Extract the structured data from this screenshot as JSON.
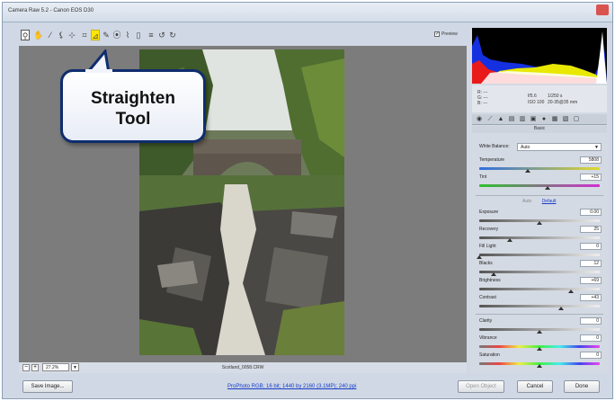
{
  "window": {
    "title": "Camera Raw 5.2 - Canon EOS D30"
  },
  "toolbar": {
    "tools": [
      {
        "name": "zoom-tool-icon",
        "glyph": "⚲"
      },
      {
        "name": "hand-tool-icon",
        "glyph": "✋"
      },
      {
        "name": "white-balance-tool-icon",
        "glyph": "⁄"
      },
      {
        "name": "color-sampler-tool-icon",
        "glyph": "⚸"
      },
      {
        "name": "targeted-adjustment-tool-icon",
        "glyph": "⊹"
      },
      {
        "name": "crop-tool-icon",
        "glyph": "⌗"
      },
      {
        "name": "straighten-tool-icon",
        "glyph": "⊿"
      },
      {
        "name": "spot-removal-tool-icon",
        "glyph": "✎"
      },
      {
        "name": "red-eye-tool-icon",
        "glyph": "⦿"
      },
      {
        "name": "adjustment-brush-icon",
        "glyph": "⌇"
      },
      {
        "name": "graduated-filter-icon",
        "glyph": "▯"
      },
      {
        "name": "preferences-icon",
        "glyph": "≡"
      },
      {
        "name": "rotate-left-icon",
        "glyph": "↺"
      },
      {
        "name": "rotate-right-icon",
        "glyph": "↻"
      }
    ],
    "active_tool_index": 6,
    "preview_label": "Preview",
    "preview_checked": true
  },
  "callout": {
    "line1": "Straighten",
    "line2": "Tool"
  },
  "status": {
    "zoom_value": "27.2%",
    "filename": "Scotland_0058.CRW"
  },
  "bottom": {
    "save_label": "Save Image...",
    "workflow_link": "ProPhoto RGB; 16 bit; 1440 by 2160 (3.1MP); 240 ppi",
    "open_label": "Open Object",
    "cancel_label": "Cancel",
    "done_label": "Done"
  },
  "info": {
    "r": "R:  ---",
    "g": "G:  ---",
    "b": "B:  ---",
    "aperture": "f/5.6",
    "shutter": "1/250 s",
    "iso": "ISO 100",
    "lens": "20-35@35 mm"
  },
  "panel": {
    "title": "Basic",
    "white_balance_label": "White Balance:",
    "white_balance_value": "Auto",
    "auto_label": "Auto",
    "default_label": "Default",
    "sliders": [
      {
        "key": "temperature",
        "label": "Temperature",
        "value": "5808",
        "fraction": 0.4,
        "track": "temp"
      },
      {
        "key": "tint",
        "label": "Tint",
        "value": "+15",
        "fraction": 0.57,
        "track": "tint"
      },
      {
        "key": "exposure",
        "label": "Exposure",
        "value": "0.00",
        "fraction": 0.5,
        "track": "gray"
      },
      {
        "key": "recovery",
        "label": "Recovery",
        "value": "25",
        "fraction": 0.25,
        "track": "gray"
      },
      {
        "key": "fill-light",
        "label": "Fill Light",
        "value": "0",
        "fraction": 0.0,
        "track": "gray"
      },
      {
        "key": "blacks",
        "label": "Blacks",
        "value": "12",
        "fraction": 0.12,
        "track": "gray"
      },
      {
        "key": "brightness",
        "label": "Brightness",
        "value": "+69",
        "fraction": 0.76,
        "track": "gray"
      },
      {
        "key": "contrast",
        "label": "Contrast",
        "value": "+43",
        "fraction": 0.68,
        "track": "gray"
      },
      {
        "key": "clarity",
        "label": "Clarity",
        "value": "0",
        "fraction": 0.5,
        "track": "gray"
      },
      {
        "key": "vibrance",
        "label": "Vibrance",
        "value": "0",
        "fraction": 0.5,
        "track": "sat"
      },
      {
        "key": "saturation",
        "label": "Saturation",
        "value": "0",
        "fraction": 0.5,
        "track": "sat"
      }
    ]
  },
  "colors": {
    "accent_yellow": "#ffe600",
    "callout_border": "#0f2d6e",
    "link_blue": "#1a3cc8"
  }
}
